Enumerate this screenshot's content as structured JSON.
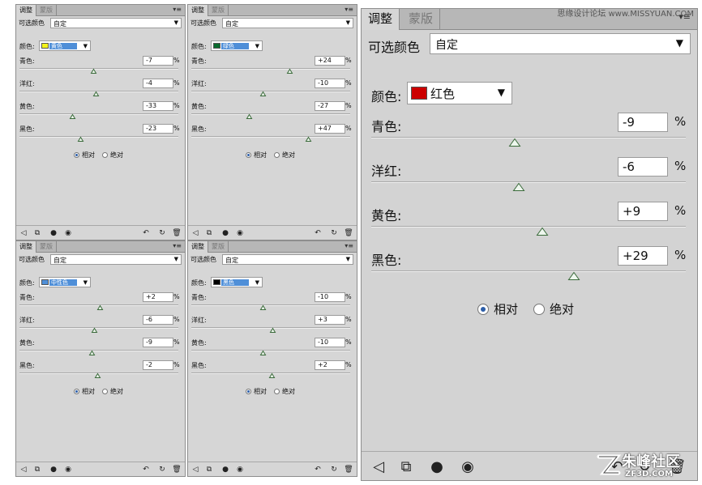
{
  "colors": {
    "panel_bg": "#d6d6d6",
    "tab_bar": "#b7b7b7",
    "radio_active": "#2d5ea8"
  },
  "common": {
    "tab_adjust": "调整",
    "tab_mask": "蒙版",
    "collapse": "▾≡",
    "preset_label": "可选颜色",
    "preset_value": "自定",
    "color_label": "颜色:",
    "pct": "%",
    "label_cyan": "青色:",
    "label_magenta": "洋红:",
    "label_yellow": "黄色:",
    "label_black": "黑色:",
    "relative": "相对",
    "absolute": "绝对"
  },
  "panels": [
    {
      "color_name": "黄色",
      "swatch": "#f3f31a",
      "dd_bg": "#4f8fd8",
      "values": [
        "-7",
        "-4",
        "-33",
        "-23"
      ],
      "slider": [
        -7,
        -4,
        -33,
        -23
      ]
    },
    {
      "color_name": "绿色",
      "swatch": "#0a6b2e",
      "dd_bg": "#4f8fd8",
      "values": [
        "+24",
        "-10",
        "-27",
        "+47"
      ],
      "slider": [
        24,
        -10,
        -27,
        47
      ]
    },
    {
      "color_name": "中性色",
      "swatch": "#4f8fd8",
      "dd_bg": "#4f8fd8",
      "values": [
        "+2",
        "-6",
        "-9",
        "-2"
      ],
      "slider": [
        2,
        -6,
        -9,
        -2
      ]
    },
    {
      "color_name": "黑色",
      "swatch": "#000000",
      "dd_bg": "#4f8fd8",
      "values": [
        "-10",
        "+3",
        "-10",
        "+2"
      ],
      "slider": [
        -10,
        3,
        -10,
        2
      ]
    },
    {
      "color_name": "红色",
      "swatch": "#cc0000",
      "dd_bg": "#ffffff",
      "values": [
        "-9",
        "-6",
        "+9",
        "+29"
      ],
      "slider": [
        -9,
        -6,
        9,
        29
      ]
    }
  ],
  "watermark": {
    "top": "思缘设计论坛 www.MISSYUAN.COM",
    "logo_main": "朱峰社区",
    "logo_sub": "ZF3D.COM"
  },
  "icons": [
    "back-arrow-icon",
    "clip-layer-icon",
    "visibility-icon",
    "eye-icon",
    "view-previous-icon",
    "reset-icon",
    "delete-icon"
  ]
}
